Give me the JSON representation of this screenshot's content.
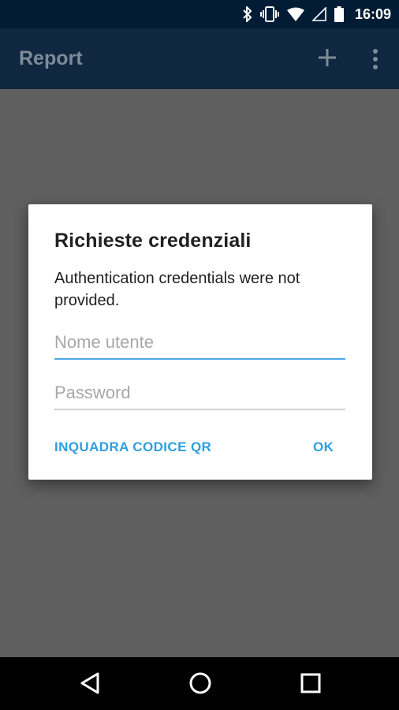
{
  "status_bar": {
    "time": "16:09",
    "icons": [
      "bluetooth-icon",
      "vibrate-icon",
      "wifi-icon",
      "signal-icon",
      "battery-icon"
    ]
  },
  "app_bar": {
    "title": "Report",
    "actions": [
      "add-icon",
      "more-vert-icon"
    ]
  },
  "dialog": {
    "title": "Richieste credenziali",
    "message": "Authentication credentials were not provided.",
    "username_placeholder": "Nome utente",
    "username_value": "",
    "password_placeholder": "Password",
    "password_value": "",
    "qr_button_label": "INQUADRA CODICE QR",
    "ok_button_label": "OK"
  },
  "nav_bar": {
    "buttons": [
      "back-icon",
      "home-icon",
      "recents-icon"
    ]
  },
  "colors": {
    "status_bar_bg": "#021c36",
    "app_bar_bg_dimmed": "#0f2740",
    "scrim": "#5f5f5f",
    "accent": "#2e9ee0",
    "focused_underline": "#4ca9e8"
  }
}
